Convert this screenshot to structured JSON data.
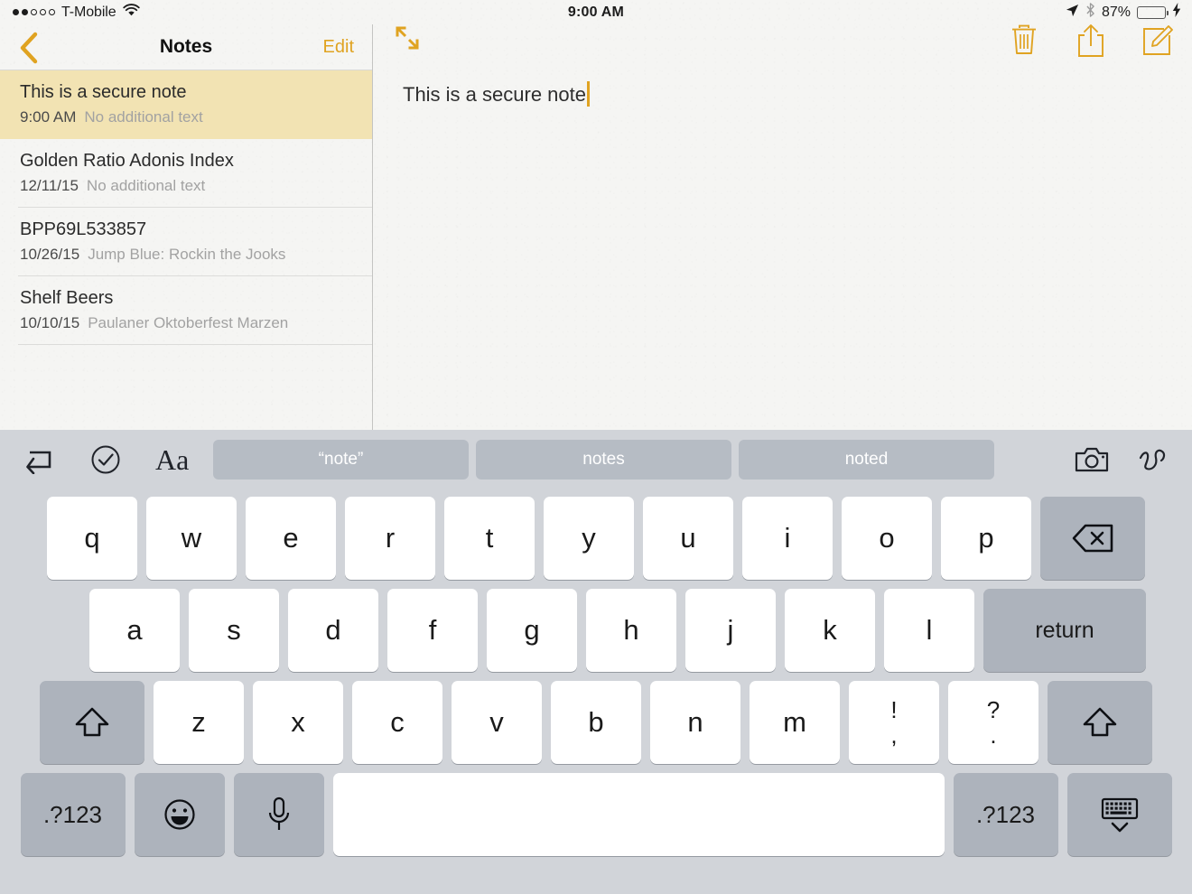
{
  "status_bar": {
    "carrier": "T-Mobile",
    "signal_filled": 2,
    "signal_total": 5,
    "wifi_icon": "wifi-icon",
    "time": "9:00 AM",
    "location_icon": "location-arrow-icon",
    "bluetooth_icon": "bluetooth-icon",
    "battery_percent": "87%",
    "battery_level": 87,
    "battery_color": "#4cd964",
    "charging_icon": "lightning-bolt-icon"
  },
  "notes_pane": {
    "back_icon": "chevron-left-icon",
    "title": "Notes",
    "edit_label": "Edit",
    "accent_color": "#e0a321",
    "selected_row_color": "#f2e3b3",
    "notes": [
      {
        "title": "This is a secure note",
        "date": "9:00 AM",
        "preview": "No additional text",
        "selected": true
      },
      {
        "title": "Golden Ratio Adonis Index",
        "date": "12/11/15",
        "preview": "No additional text",
        "selected": false
      },
      {
        "title": "BPP69L533857",
        "date": "10/26/15",
        "preview": "Jump Blue: Rockin the Jooks",
        "selected": false
      },
      {
        "title": "Shelf Beers",
        "date": "10/10/15",
        "preview": "Paulaner Oktoberfest Marzen",
        "selected": false
      }
    ]
  },
  "editor": {
    "expand_icon": "expand-diagonal-arrows-icon",
    "delete_icon": "trash-icon",
    "share_icon": "share-icon",
    "compose_icon": "compose-icon",
    "body_text": "This is a secure note",
    "caret_color": "#e0a321"
  },
  "keyboard": {
    "toolbar_left": [
      {
        "name": "undo-redo-icon"
      },
      {
        "name": "checklist-circle-icon"
      },
      {
        "name": "text-format-aa-icon",
        "label": "Aa"
      }
    ],
    "suggestions": [
      "“note”",
      "notes",
      "noted"
    ],
    "toolbar_right": [
      {
        "name": "camera-icon"
      },
      {
        "name": "handwriting-squiggle-icon"
      }
    ],
    "row1": [
      "q",
      "w",
      "e",
      "r",
      "t",
      "y",
      "u",
      "i",
      "o",
      "p"
    ],
    "backspace_icon": "backspace-delete-icon",
    "row2": [
      "a",
      "s",
      "d",
      "f",
      "g",
      "h",
      "j",
      "k",
      "l"
    ],
    "return_label": "return",
    "row3": [
      "z",
      "x",
      "c",
      "v",
      "b",
      "n",
      "m"
    ],
    "punct_keys": [
      {
        "upper": "!",
        "lower": ","
      },
      {
        "upper": "?",
        "lower": "."
      }
    ],
    "shift_icon": "shift-arrow-icon",
    "numeric_label": ".?123",
    "emoji_icon": "emoji-smiley-icon",
    "mic_icon": "microphone-icon",
    "space_label": "",
    "hide_keyboard_icon": "hide-keyboard-icon"
  }
}
